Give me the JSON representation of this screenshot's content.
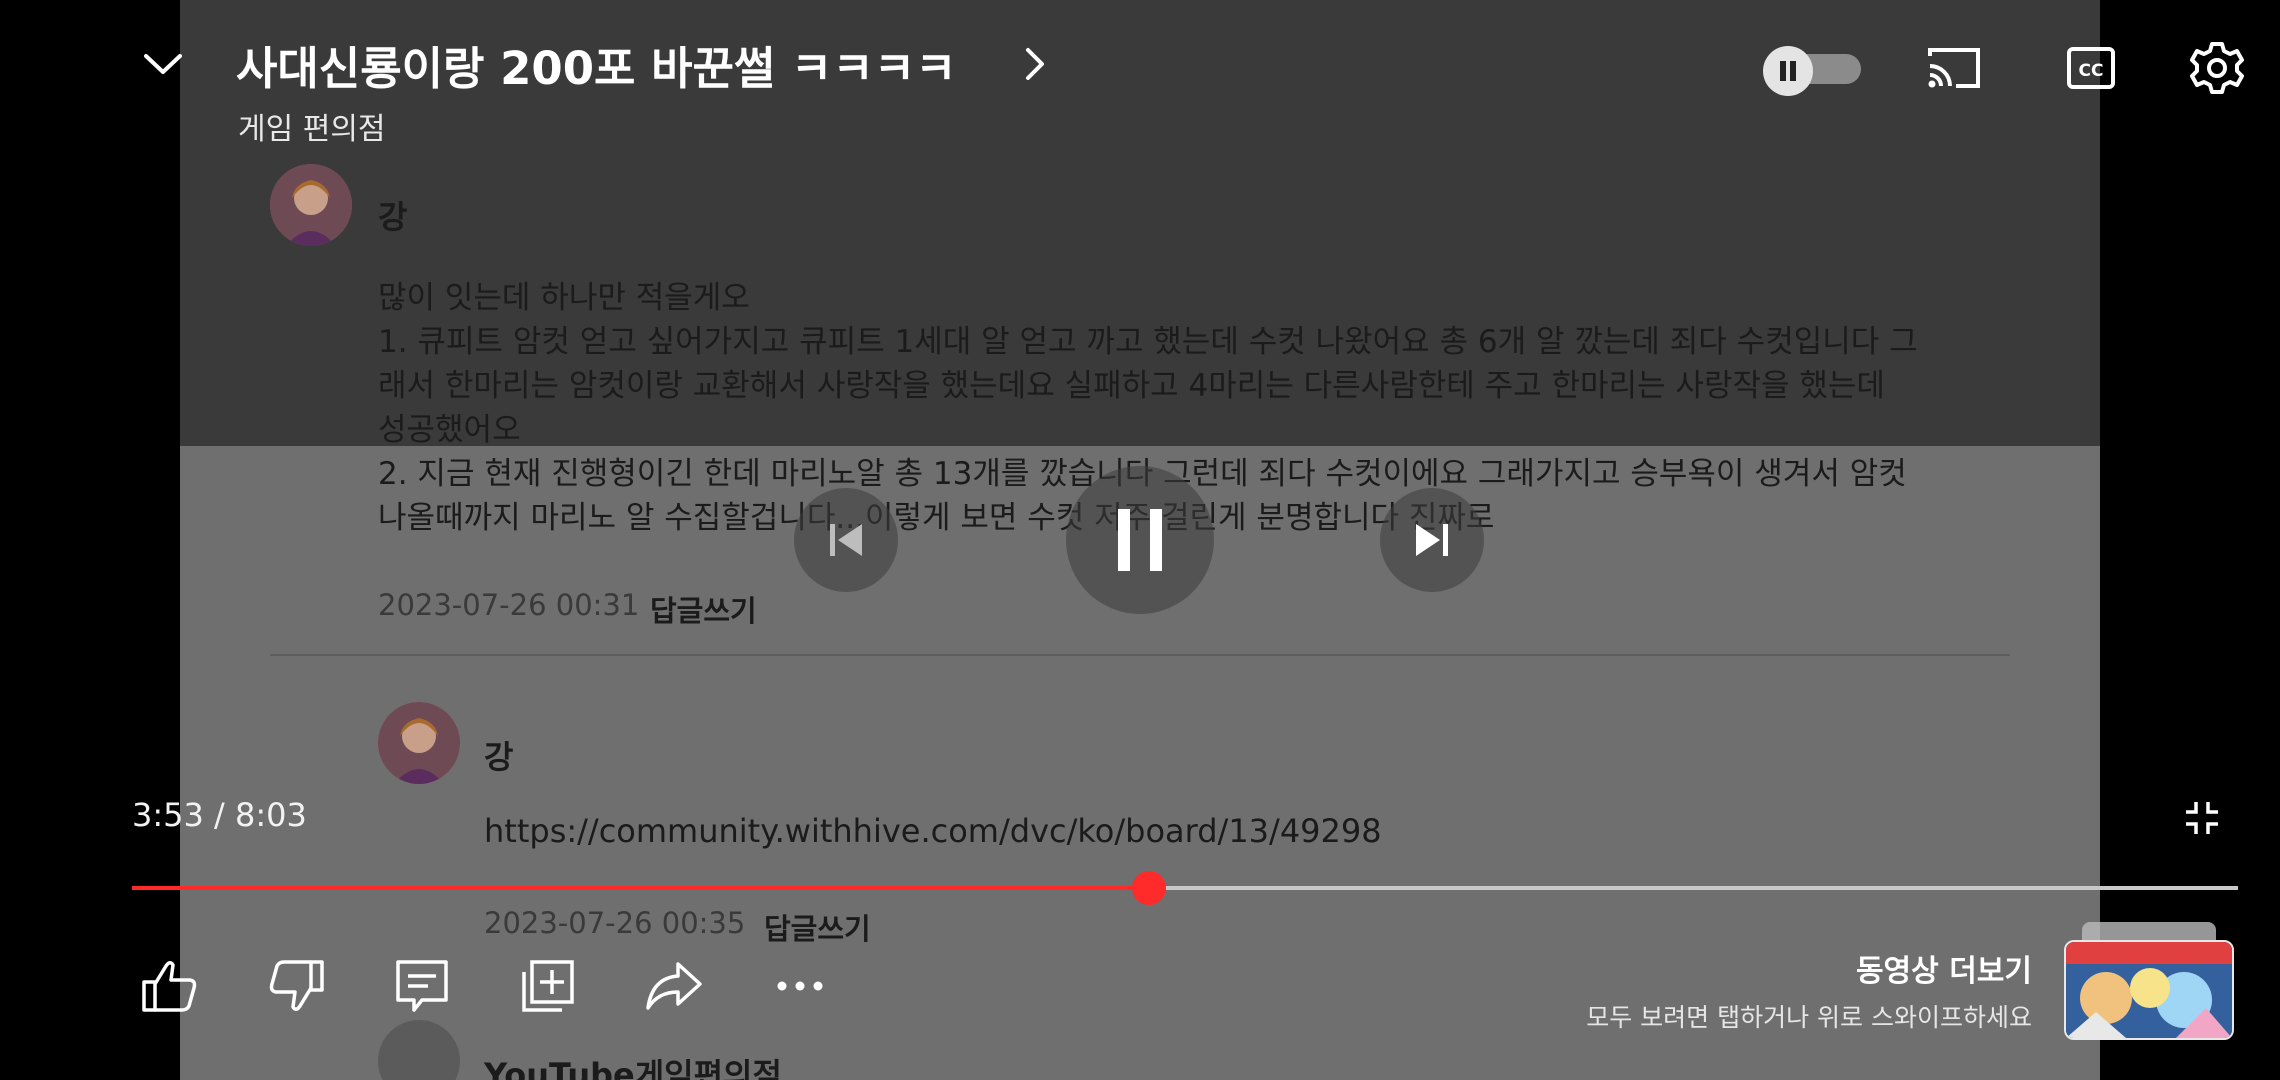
{
  "video": {
    "title": "사대신룡이랑 200포 바꾼썰 ㅋㅋㅋㅋ",
    "channel": "게임 편의점",
    "elapsed": "3:53",
    "duration": "8:03",
    "time_separator": " / ",
    "progress": 0.483
  },
  "content": {
    "comment1_author": "강",
    "comment1_line1": "많이 잇는데 하나만 적을게오",
    "comment1_line2": "1. 큐피트 암컷 얻고 싶어가지고 큐피트 1세대 알 얻고 까고 했는데 수컷 나왔어요 총 6개 알 깠는데 죄다 수컷입니다 그",
    "comment1_line3": "래서 한마리는 암컷이랑 교환해서 사랑작을 했는데요 실패하고 4마리는 다른사람한테 주고 한마리는 사랑작을 했는데",
    "comment1_line4": "성공했어오",
    "comment1_line5": "2. 지금 현재 진행형이긴 한데 마리노알 총 13개를 깠습니다 그런데 죄다 수컷이에요 그래가지고 승부욕이 생겨서 암컷",
    "comment1_line6": "나올때까지 마리노 알 수집할겁니다...이렇게 보면 수컷 저주 걸린게 분명합니다 진짜로",
    "comment1_date": "2023-07-26 00:31",
    "reply_label": "답글쓰기",
    "comment2_author": "강",
    "comment2_text": "https://community.withhive.com/dvc/ko/board/13/49298",
    "comment2_date": "2023-07-26 00:35",
    "comment3_author": "YouTube게임편의점"
  },
  "more_videos": {
    "title": "동영상 더보기",
    "subtitle": "모두 보려면 탭하거나 위로 스와이프하세요"
  },
  "icons": {
    "collapse": "chevron-down-icon",
    "autoplay": "autoplay-toggle-icon",
    "cast": "cast-icon",
    "captions": "cc-icon",
    "settings": "gear-icon",
    "previous": "skip-previous-icon",
    "play_pause": "pause-icon",
    "next": "skip-next-icon",
    "fullscreen": "exit-fullscreen-icon",
    "like": "thumbs-up-icon",
    "dislike": "thumbs-down-icon",
    "comments": "comment-icon",
    "save": "add-to-playlist-icon",
    "share": "share-icon",
    "more": "more-icon"
  },
  "colors": {
    "progress_played": "#ff2a2a",
    "progress_track": "#c8c8c8"
  }
}
